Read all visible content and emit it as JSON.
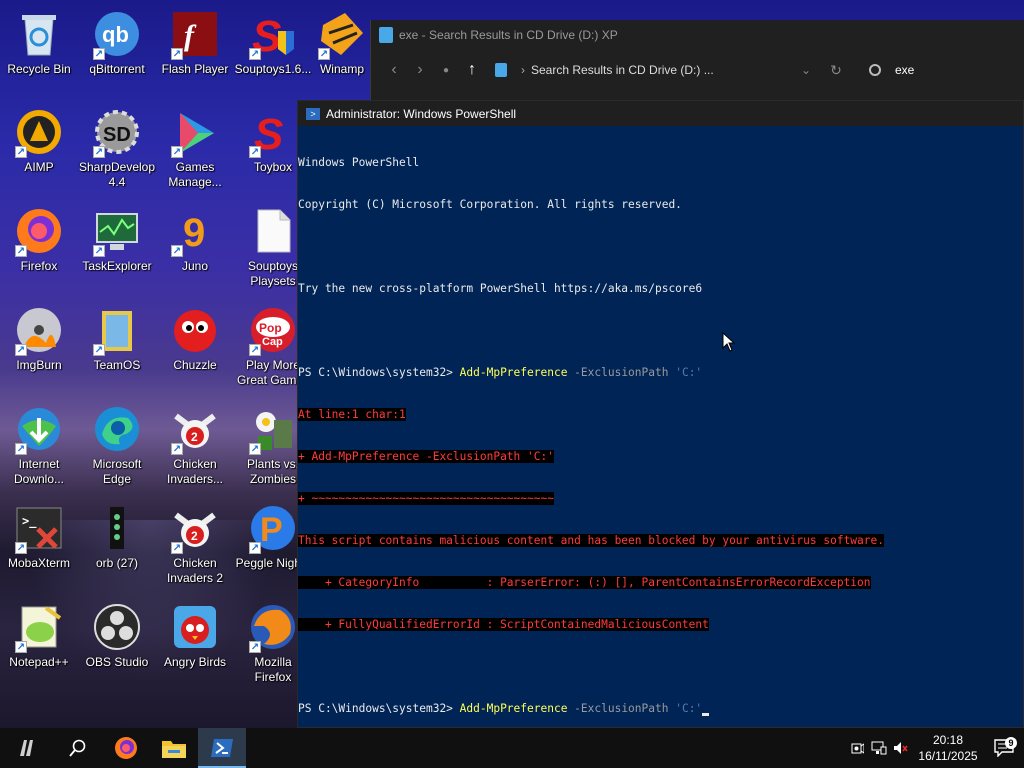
{
  "desktop": {
    "icons": [
      {
        "label": "Recycle Bin"
      },
      {
        "label": "qBittorrent"
      },
      {
        "label": "Flash Player"
      },
      {
        "label": "Souptoys1.6..."
      },
      {
        "label": "Winamp"
      },
      {
        "label": "AIMP"
      },
      {
        "label": "SharpDevelop\n4.4"
      },
      {
        "label": "Games\nManage..."
      },
      {
        "label": "Toybox"
      },
      {
        "label": "Firefox"
      },
      {
        "label": "TaskExplorer"
      },
      {
        "label": "Juno"
      },
      {
        "label": "Souptoys\nPlaysets"
      },
      {
        "label": "ImgBurn"
      },
      {
        "label": "TeamOS"
      },
      {
        "label": "Chuzzle"
      },
      {
        "label": "Play More\nGreat Games"
      },
      {
        "label": "Internet\nDownlo..."
      },
      {
        "label": "Microsoft\nEdge"
      },
      {
        "label": "Chicken\nInvaders..."
      },
      {
        "label": "Plants vs.\nZombies"
      },
      {
        "label": "MobaXterm"
      },
      {
        "label": "orb (27)"
      },
      {
        "label": "Chicken\nInvaders 2"
      },
      {
        "label": "Peggle Nights"
      },
      {
        "label": "Notepad++"
      },
      {
        "label": "OBS Studio"
      },
      {
        "label": "Angry Birds"
      },
      {
        "label": "Mozilla\nFirefox"
      }
    ]
  },
  "explorer": {
    "title": "exe - Search Results in CD Drive (D:) XP",
    "address": "Search Results in CD Drive (D:) ...",
    "search_value": "exe"
  },
  "powershell": {
    "title": "Administrator: Windows PowerShell",
    "banner1": "Windows PowerShell",
    "banner2": "Copyright (C) Microsoft Corporation. All rights reserved.",
    "banner3": "Try the new cross-platform PowerShell https://aka.ms/pscore6",
    "prompt": "PS C:\\Windows\\system32> ",
    "cmd": "Add-MpPreference",
    "param": " -ExclusionPath ",
    "arg": "'C:'",
    "err1": "At line:1 char:1",
    "err2": "+ Add-MpPreference -ExclusionPath 'C:'",
    "err3": "+ ~~~~~~~~~~~~~~~~~~~~~~~~~~~~~~~~~~~~",
    "err4": "This script contains malicious content and has been blocked by your antivirus software.",
    "err5": "    + CategoryInfo          : ParserError: (:) [], ParentContainsErrorRecordException",
    "err6": "    + FullyQualifiedErrorId : ScriptContainedMaliciousContent",
    "arg2": "'C:'"
  },
  "taskbar": {
    "time": "20:18",
    "date": "16/11/2025",
    "notification_count": "9"
  }
}
